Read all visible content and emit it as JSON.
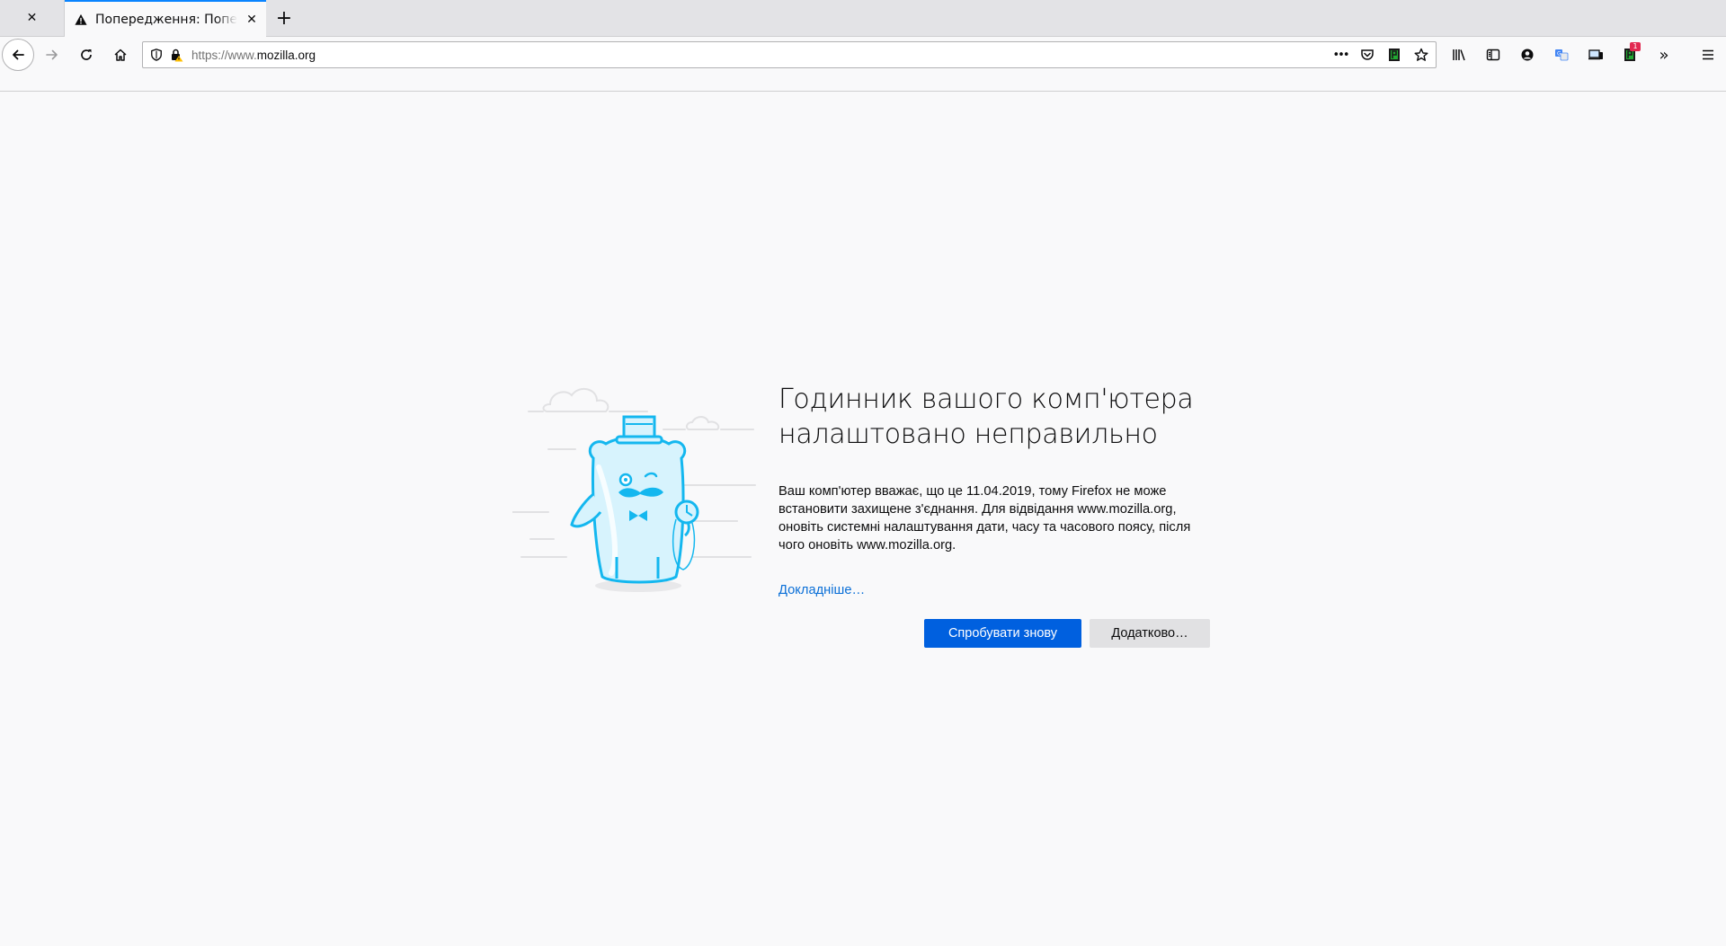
{
  "colors": {
    "accent": "#0a84ff",
    "primary_button": "#0060df",
    "link": "#0a6fd7",
    "background": "#f9f9fa",
    "badge": "#e22850",
    "illustration_blue": "#14b7ef"
  },
  "tabs": {
    "active_title": "Попередження: Попередження: можлива загроза безпеці",
    "new_tab_symbol": "+",
    "close_symbol": "✕"
  },
  "navbar": {
    "url_prefix": "https://www.",
    "url_domain": "mozilla.org",
    "page_actions_symbol": "•••",
    "extensions_badge": "1",
    "overflow_symbol": "»"
  },
  "error": {
    "title": "Годинник вашого комп'ютера налаштовано неправильно",
    "description": "Ваш комп'ютер вважає, що це 11.04.2019, тому Firefox не може встановити захищене з'єднання. Для відвідання www.mozilla.org, оновіть системні налаштування дати, часу та часового поясу, після чого оновіть www.mozilla.org.",
    "learn_more": "Докладніше…",
    "try_again": "Спробувати знову",
    "advanced": "Додатково…"
  }
}
